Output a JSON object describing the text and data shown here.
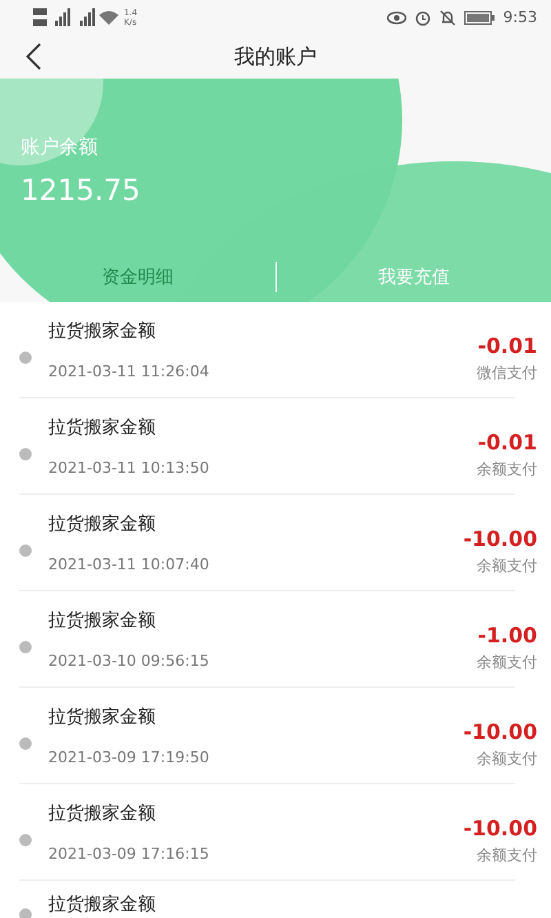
{
  "status_bar": {
    "speed": "1.4",
    "speed_unit": "K/s",
    "time": "9:53"
  },
  "header": {
    "title": "我的账户"
  },
  "balance": {
    "label": "账户余额",
    "amount": "1215.75"
  },
  "tabs": [
    {
      "label": "资金明细",
      "selected": true
    },
    {
      "label": "我要充值",
      "selected": false
    }
  ],
  "records": [
    {
      "title": "拉货搬家金额",
      "time": "2021-03-11 11:26:04",
      "amount": "-0.01",
      "method": "微信支付"
    },
    {
      "title": "拉货搬家金额",
      "time": "2021-03-11 10:13:50",
      "amount": "-0.01",
      "method": "余额支付"
    },
    {
      "title": "拉货搬家金额",
      "time": "2021-03-11 10:07:40",
      "amount": "-10.00",
      "method": "余额支付"
    },
    {
      "title": "拉货搬家金额",
      "time": "2021-03-10 09:56:15",
      "amount": "-1.00",
      "method": "余额支付"
    },
    {
      "title": "拉货搬家金额",
      "time": "2021-03-09 17:19:50",
      "amount": "-10.00",
      "method": "余额支付"
    },
    {
      "title": "拉货搬家金额",
      "time": "2021-03-09 17:16:15",
      "amount": "-10.00",
      "method": "余额支付"
    },
    {
      "title": "拉货搬家金额"
    }
  ]
}
